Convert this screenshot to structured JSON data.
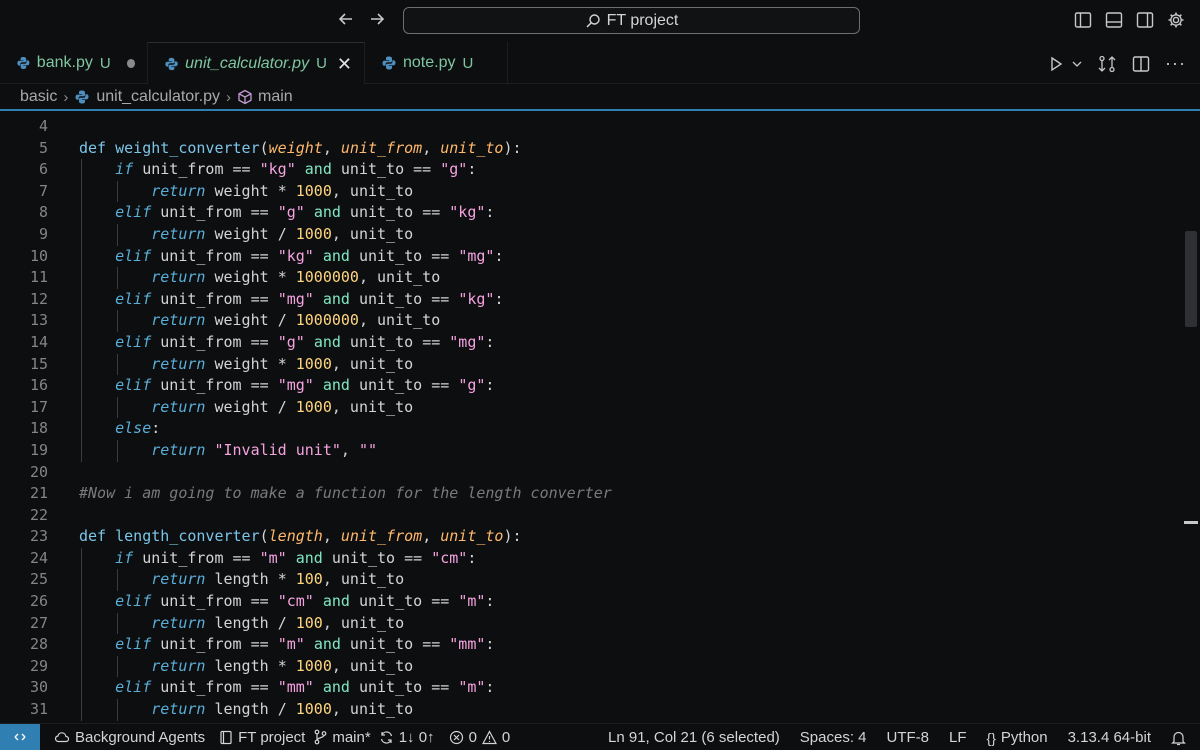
{
  "title_bar": {
    "search_text": "FT project",
    "back_icon": "arrow-left-icon",
    "forward_icon": "arrow-right-icon"
  },
  "tabs": [
    {
      "name": "bank.py",
      "status": "U",
      "state": "dirty"
    },
    {
      "name": "unit_calculator.py",
      "status": "U",
      "state": "active"
    },
    {
      "name": "note.py",
      "status": "U",
      "state": "normal"
    }
  ],
  "breadcrumb": {
    "folder": "basic",
    "file": "unit_calculator.py",
    "symbol": "main"
  },
  "code_lines": [
    {
      "n": "4",
      "text": ""
    },
    {
      "n": "5",
      "text": "def weight_converter(weight, unit_from, unit_to):"
    },
    {
      "n": "6",
      "text": "    if unit_from == \"kg\" and unit_to == \"g\":"
    },
    {
      "n": "7",
      "text": "        return weight * 1000, unit_to"
    },
    {
      "n": "8",
      "text": "    elif unit_from == \"g\" and unit_to == \"kg\":"
    },
    {
      "n": "9",
      "text": "        return weight / 1000, unit_to"
    },
    {
      "n": "10",
      "text": "    elif unit_from == \"kg\" and unit_to == \"mg\":"
    },
    {
      "n": "11",
      "text": "        return weight * 1000000, unit_to"
    },
    {
      "n": "12",
      "text": "    elif unit_from == \"mg\" and unit_to == \"kg\":"
    },
    {
      "n": "13",
      "text": "        return weight / 1000000, unit_to"
    },
    {
      "n": "14",
      "text": "    elif unit_from == \"g\" and unit_to == \"mg\":"
    },
    {
      "n": "15",
      "text": "        return weight * 1000, unit_to"
    },
    {
      "n": "16",
      "text": "    elif unit_from == \"mg\" and unit_to == \"g\":"
    },
    {
      "n": "17",
      "text": "        return weight / 1000, unit_to"
    },
    {
      "n": "18",
      "text": "    else:"
    },
    {
      "n": "19",
      "text": "        return \"Invalid unit\", \"\""
    },
    {
      "n": "20",
      "text": ""
    },
    {
      "n": "21",
      "text": "#Now i am going to make a function for the length converter"
    },
    {
      "n": "22",
      "text": ""
    },
    {
      "n": "23",
      "text": "def length_converter(length, unit_from, unit_to):"
    },
    {
      "n": "24",
      "text": "    if unit_from == \"m\" and unit_to == \"cm\":"
    },
    {
      "n": "25",
      "text": "        return length * 100, unit_to"
    },
    {
      "n": "26",
      "text": "    elif unit_from == \"cm\" and unit_to == \"m\":"
    },
    {
      "n": "27",
      "text": "        return length / 100, unit_to"
    },
    {
      "n": "28",
      "text": "    elif unit_from == \"m\" and unit_to == \"mm\":"
    },
    {
      "n": "29",
      "text": "        return length * 1000, unit_to"
    },
    {
      "n": "30",
      "text": "    elif unit_from == \"mm\" and unit_to == \"m\":"
    },
    {
      "n": "31",
      "text": "        return length / 1000, unit_to"
    }
  ],
  "status_bar": {
    "background_agents": "Background Agents",
    "project": "FT project",
    "branch": "main*",
    "sync": "1↓ 0↑",
    "errors": "0",
    "warnings": "0",
    "cursor": "Ln 91, Col 21 (6 selected)",
    "spaces": "Spaces: 4",
    "encoding": "UTF-8",
    "eol": "LF",
    "language": "Python",
    "interpreter": "3.13.4 64-bit"
  },
  "colors": {
    "accent": "#2f7fb3",
    "untracked": "#7fc6a0",
    "keyword": "#7cc5e8",
    "string": "#f5a3e0",
    "number": "#ffd580",
    "parameter": "#ffb86c",
    "comment": "#7a7a7a"
  }
}
